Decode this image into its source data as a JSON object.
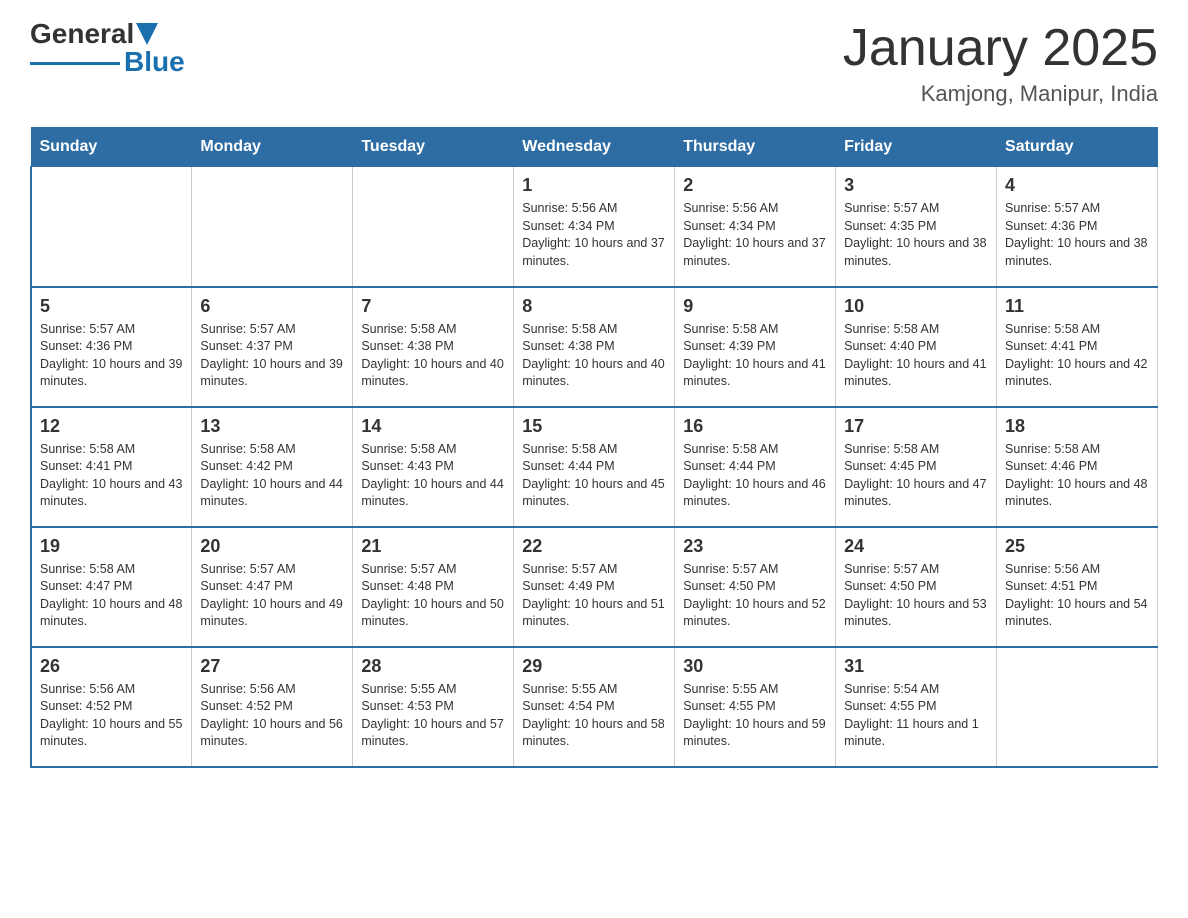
{
  "header": {
    "logo_text_black": "General",
    "logo_text_blue": "Blue",
    "calendar_title": "January 2025",
    "calendar_subtitle": "Kamjong, Manipur, India"
  },
  "weekdays": [
    "Sunday",
    "Monday",
    "Tuesday",
    "Wednesday",
    "Thursday",
    "Friday",
    "Saturday"
  ],
  "weeks": [
    [
      {
        "day": "",
        "info": ""
      },
      {
        "day": "",
        "info": ""
      },
      {
        "day": "",
        "info": ""
      },
      {
        "day": "1",
        "info": "Sunrise: 5:56 AM\nSunset: 4:34 PM\nDaylight: 10 hours and 37 minutes."
      },
      {
        "day": "2",
        "info": "Sunrise: 5:56 AM\nSunset: 4:34 PM\nDaylight: 10 hours and 37 minutes."
      },
      {
        "day": "3",
        "info": "Sunrise: 5:57 AM\nSunset: 4:35 PM\nDaylight: 10 hours and 38 minutes."
      },
      {
        "day": "4",
        "info": "Sunrise: 5:57 AM\nSunset: 4:36 PM\nDaylight: 10 hours and 38 minutes."
      }
    ],
    [
      {
        "day": "5",
        "info": "Sunrise: 5:57 AM\nSunset: 4:36 PM\nDaylight: 10 hours and 39 minutes."
      },
      {
        "day": "6",
        "info": "Sunrise: 5:57 AM\nSunset: 4:37 PM\nDaylight: 10 hours and 39 minutes."
      },
      {
        "day": "7",
        "info": "Sunrise: 5:58 AM\nSunset: 4:38 PM\nDaylight: 10 hours and 40 minutes."
      },
      {
        "day": "8",
        "info": "Sunrise: 5:58 AM\nSunset: 4:38 PM\nDaylight: 10 hours and 40 minutes."
      },
      {
        "day": "9",
        "info": "Sunrise: 5:58 AM\nSunset: 4:39 PM\nDaylight: 10 hours and 41 minutes."
      },
      {
        "day": "10",
        "info": "Sunrise: 5:58 AM\nSunset: 4:40 PM\nDaylight: 10 hours and 41 minutes."
      },
      {
        "day": "11",
        "info": "Sunrise: 5:58 AM\nSunset: 4:41 PM\nDaylight: 10 hours and 42 minutes."
      }
    ],
    [
      {
        "day": "12",
        "info": "Sunrise: 5:58 AM\nSunset: 4:41 PM\nDaylight: 10 hours and 43 minutes."
      },
      {
        "day": "13",
        "info": "Sunrise: 5:58 AM\nSunset: 4:42 PM\nDaylight: 10 hours and 44 minutes."
      },
      {
        "day": "14",
        "info": "Sunrise: 5:58 AM\nSunset: 4:43 PM\nDaylight: 10 hours and 44 minutes."
      },
      {
        "day": "15",
        "info": "Sunrise: 5:58 AM\nSunset: 4:44 PM\nDaylight: 10 hours and 45 minutes."
      },
      {
        "day": "16",
        "info": "Sunrise: 5:58 AM\nSunset: 4:44 PM\nDaylight: 10 hours and 46 minutes."
      },
      {
        "day": "17",
        "info": "Sunrise: 5:58 AM\nSunset: 4:45 PM\nDaylight: 10 hours and 47 minutes."
      },
      {
        "day": "18",
        "info": "Sunrise: 5:58 AM\nSunset: 4:46 PM\nDaylight: 10 hours and 48 minutes."
      }
    ],
    [
      {
        "day": "19",
        "info": "Sunrise: 5:58 AM\nSunset: 4:47 PM\nDaylight: 10 hours and 48 minutes."
      },
      {
        "day": "20",
        "info": "Sunrise: 5:57 AM\nSunset: 4:47 PM\nDaylight: 10 hours and 49 minutes."
      },
      {
        "day": "21",
        "info": "Sunrise: 5:57 AM\nSunset: 4:48 PM\nDaylight: 10 hours and 50 minutes."
      },
      {
        "day": "22",
        "info": "Sunrise: 5:57 AM\nSunset: 4:49 PM\nDaylight: 10 hours and 51 minutes."
      },
      {
        "day": "23",
        "info": "Sunrise: 5:57 AM\nSunset: 4:50 PM\nDaylight: 10 hours and 52 minutes."
      },
      {
        "day": "24",
        "info": "Sunrise: 5:57 AM\nSunset: 4:50 PM\nDaylight: 10 hours and 53 minutes."
      },
      {
        "day": "25",
        "info": "Sunrise: 5:56 AM\nSunset: 4:51 PM\nDaylight: 10 hours and 54 minutes."
      }
    ],
    [
      {
        "day": "26",
        "info": "Sunrise: 5:56 AM\nSunset: 4:52 PM\nDaylight: 10 hours and 55 minutes."
      },
      {
        "day": "27",
        "info": "Sunrise: 5:56 AM\nSunset: 4:52 PM\nDaylight: 10 hours and 56 minutes."
      },
      {
        "day": "28",
        "info": "Sunrise: 5:55 AM\nSunset: 4:53 PM\nDaylight: 10 hours and 57 minutes."
      },
      {
        "day": "29",
        "info": "Sunrise: 5:55 AM\nSunset: 4:54 PM\nDaylight: 10 hours and 58 minutes."
      },
      {
        "day": "30",
        "info": "Sunrise: 5:55 AM\nSunset: 4:55 PM\nDaylight: 10 hours and 59 minutes."
      },
      {
        "day": "31",
        "info": "Sunrise: 5:54 AM\nSunset: 4:55 PM\nDaylight: 11 hours and 1 minute."
      },
      {
        "day": "",
        "info": ""
      }
    ]
  ]
}
